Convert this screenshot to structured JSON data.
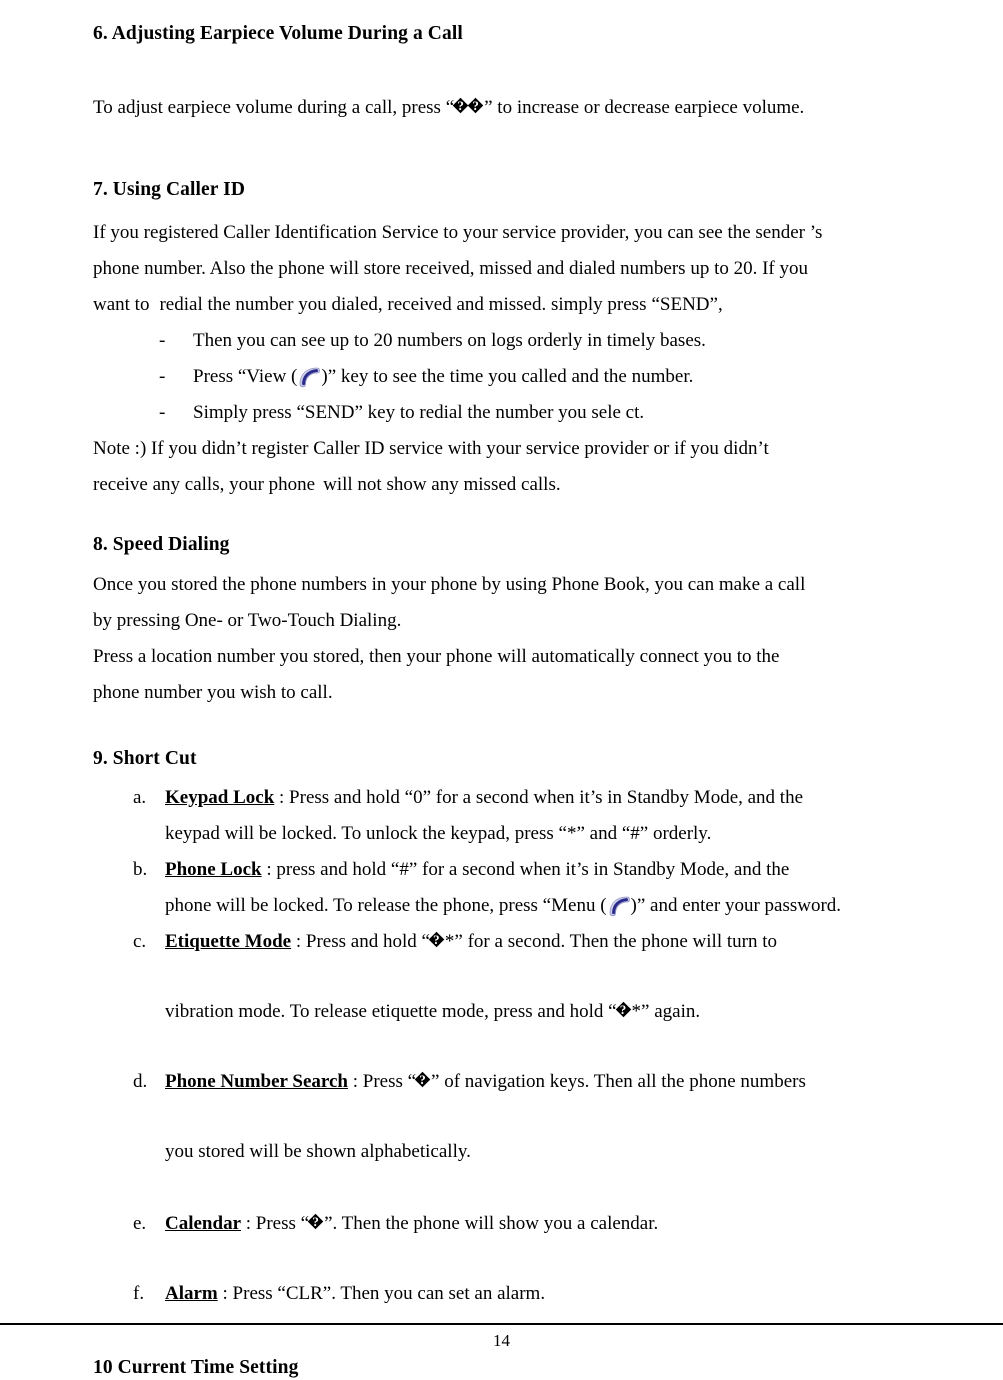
{
  "document": {
    "page_number": "14",
    "icon_colors": {
      "key_icon_fill_light": "#d7d8ee",
      "key_icon_fill_mid": "#b9bbdd",
      "key_icon_stroke_dark": "#2b2b8c",
      "text_color": "#000000"
    }
  },
  "sections": {
    "s6": {
      "heading": "6. Adjusting Earpiece Volume During a Call",
      "line1_a": "To adjust earpiece volume during a call, press “",
      "line1_b": "” to inc",
      "line1_c": "rease or decrease earpiece volume."
    },
    "s7": {
      "heading": "7. Using Caller ID",
      "line1": "If you registered Caller Identification Service to your service provider, you can see the sender ’s",
      "line2": "phone number. Also the phone will store received, missed and dialed numbers up to 20. If you",
      "line3_a": "want to",
      "line3_b": "redial the number you dialed, received and missed. simply press",
      "line3_c": "“SEND”,",
      "bullets": [
        {
          "marker": "-",
          "text": "Then you can see up to 20 numbers on logs orderly in timely bases."
        },
        {
          "marker": "-",
          "pre": "Press “View (",
          "post": ")” key to see the time you called and the number."
        },
        {
          "marker": "-",
          "text": "Simply press “SEND” key to redial the number you sele ct."
        }
      ],
      "note_line1": "Note :) If you didn’t register Caller ID service with your service provider or if you didn’t",
      "note_line2_a": "receive any calls, your phone",
      "note_line2_b": "will not show any missed calls."
    },
    "s8": {
      "heading": "8. Speed Dialing",
      "line1_a": "Once you stored the phone numbers in your phone by using Phone Book, you can mak",
      "line1_b": "e a call",
      "line2": "by pressing One- or Two-Touch Dialing.",
      "line3": "Press a location number you stored, then your phone will automatically connect you to the",
      "line4": "phone number you wish to call."
    },
    "s9": {
      "heading": "9. Short Cut",
      "items": [
        {
          "marker": "a.",
          "term": "Keypad Lock",
          "line1_a": " : Press and hold “0” for a second when it’s in Standby Mode,",
          "line1_b": " and the",
          "line2": "keypad will be locked. To unlock the keypad, press “*” and “#” orderly."
        },
        {
          "marker": "b.",
          "term": "Phone Lock",
          "line1": " : press and hold “#” for a second when it’s in Standby Mode, and the",
          "line2_a": "phone will be locked. To release the phone, press “Menu (",
          "line2_b": ")” and enter your password."
        },
        {
          "marker": "c.",
          "term": "Etiquette Mode",
          "line1_a": " : Press and hold “",
          "line1_b": "*” for a second. Then the phone will turn to",
          "line2_a": "vibration mode. To release etiquette mode, press and hold “",
          "line2_b": "*” again."
        },
        {
          "marker": "d.",
          "term": "Phone Number Search",
          "line1_a": " : Press “",
          "line1_b": "” of navigation keys. Then all the phone numbers",
          "line2": "you stored will be shown alphabetically."
        },
        {
          "marker": "e.",
          "term": "Calendar",
          "line1_a": " : Press “",
          "line1_b": "”. Then the phone will show you a calendar."
        },
        {
          "marker": "f.",
          "term": "Alarm",
          "line1": " : Press “CLR”. Then you can set an alarm."
        }
      ]
    },
    "s10": {
      "heading": "10 Current Time Setting"
    }
  }
}
